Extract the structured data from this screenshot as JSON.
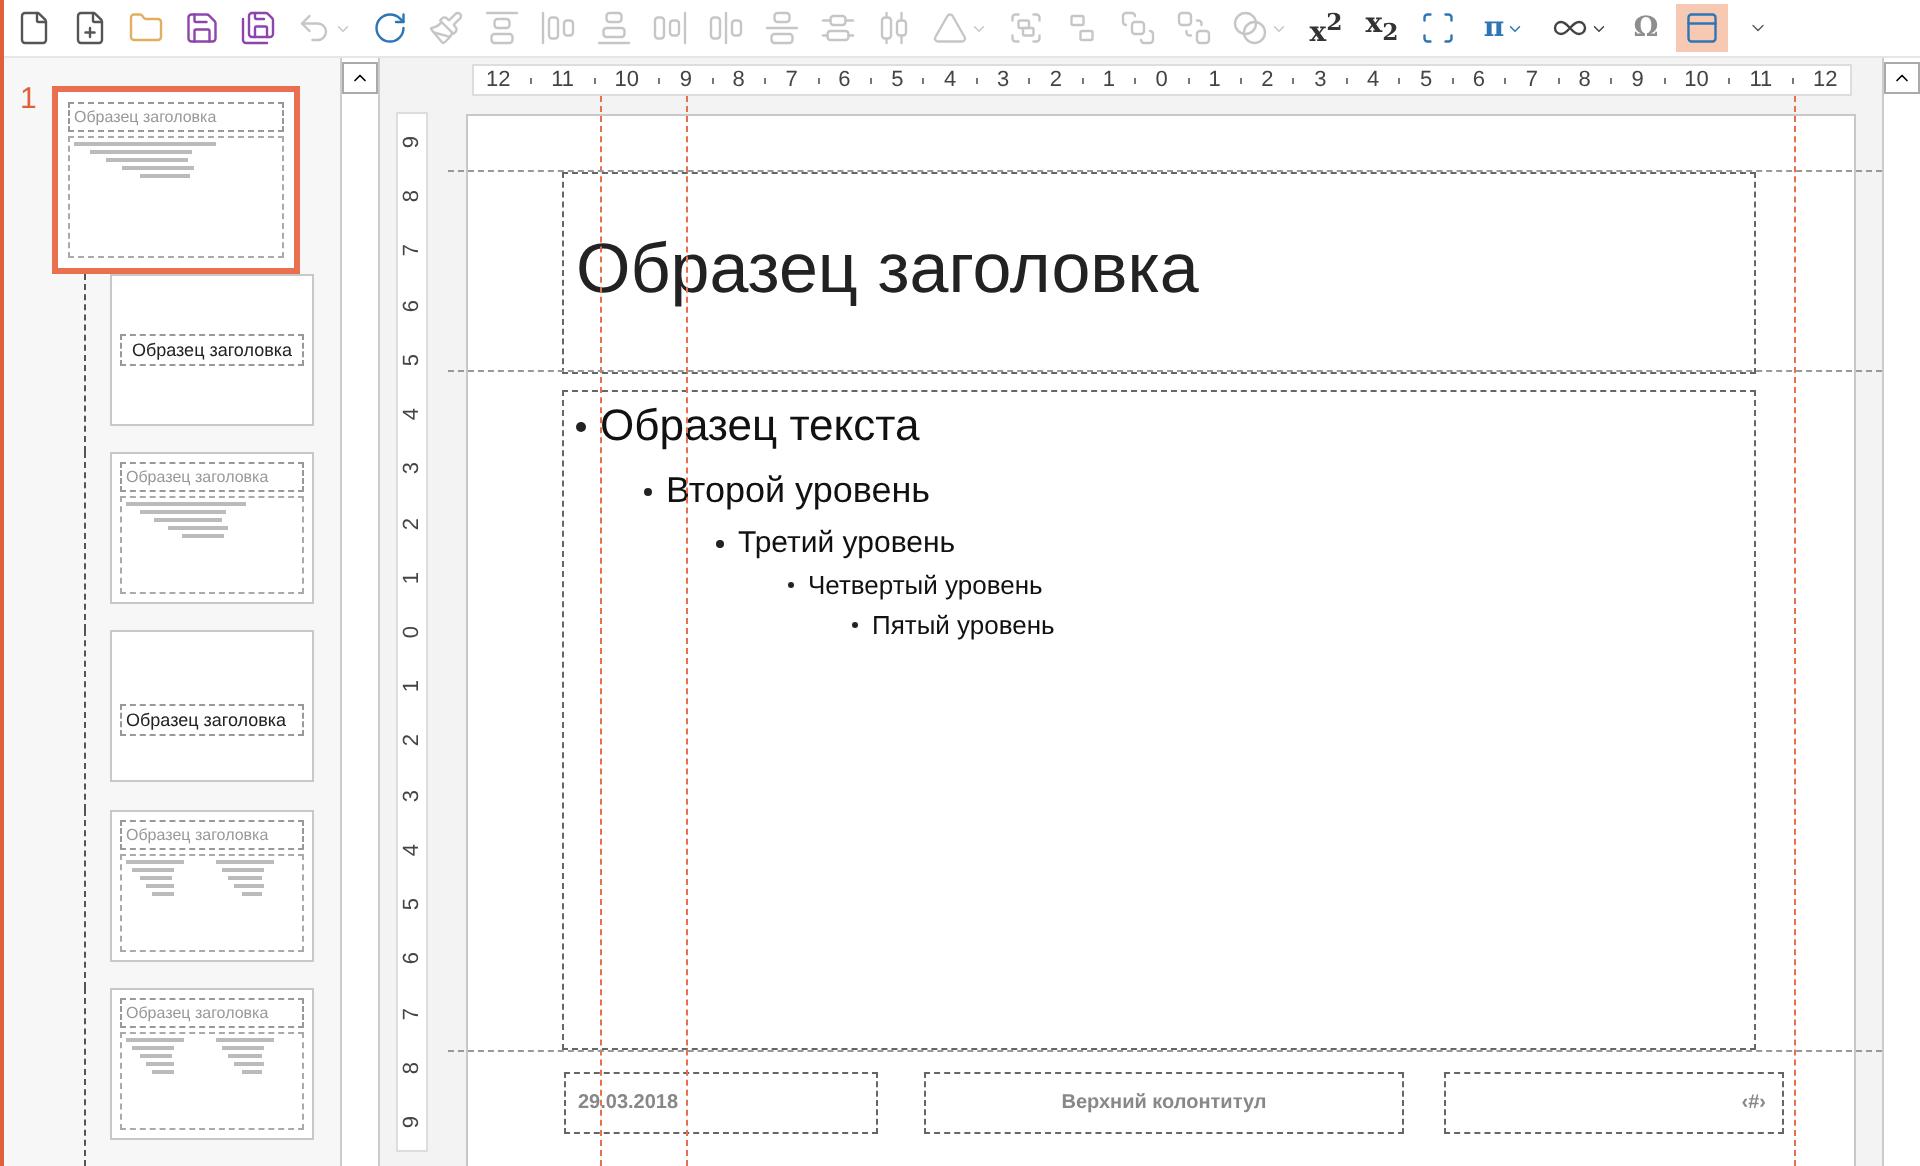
{
  "toolbar": [
    {
      "kind": "new",
      "dropdown": false,
      "selected": false
    },
    {
      "kind": "new-blank",
      "dropdown": false,
      "selected": false
    },
    {
      "kind": "open",
      "dropdown": false,
      "selected": false
    },
    {
      "kind": "save",
      "dropdown": false,
      "selected": false
    },
    {
      "kind": "save-as",
      "dropdown": false,
      "selected": false
    },
    {
      "kind": "undo",
      "dropdown": true,
      "selected": false,
      "disabled": true
    },
    {
      "kind": "redo",
      "dropdown": false,
      "selected": false
    },
    {
      "kind": "format-painter",
      "dropdown": false,
      "selected": false,
      "disabled": true
    },
    {
      "kind": "align-top",
      "dropdown": false,
      "selected": false,
      "disabled": true
    },
    {
      "kind": "align-left",
      "dropdown": false,
      "selected": false,
      "disabled": true
    },
    {
      "kind": "align-bottom",
      "dropdown": false,
      "selected": false,
      "disabled": true
    },
    {
      "kind": "align-right",
      "dropdown": false,
      "selected": false,
      "disabled": true
    },
    {
      "kind": "align-center",
      "dropdown": false,
      "selected": false,
      "disabled": true
    },
    {
      "kind": "align-middle",
      "dropdown": false,
      "selected": false,
      "disabled": true
    },
    {
      "kind": "distribute-vertical",
      "dropdown": false,
      "selected": false,
      "disabled": true
    },
    {
      "kind": "distribute-horizontal",
      "dropdown": false,
      "selected": false,
      "disabled": true
    },
    {
      "kind": "rotate",
      "dropdown": true,
      "selected": false,
      "disabled": true
    },
    {
      "kind": "group",
      "dropdown": false,
      "selected": false,
      "disabled": true
    },
    {
      "kind": "ungroup",
      "dropdown": false,
      "selected": false,
      "disabled": true
    },
    {
      "kind": "bring-front",
      "dropdown": false,
      "selected": false,
      "disabled": true
    },
    {
      "kind": "send-back",
      "dropdown": false,
      "selected": false,
      "disabled": true
    },
    {
      "kind": "shapes",
      "dropdown": true,
      "selected": false,
      "disabled": true
    },
    {
      "kind": "text",
      "label": "x$^{2}$",
      "dropdown": false,
      "selected": false
    },
    {
      "kind": "text",
      "label": "x$_{2}$",
      "dropdown": false,
      "selected": false
    },
    {
      "kind": "fit",
      "dropdown": false,
      "selected": false
    },
    {
      "kind": "text",
      "label": "π",
      "dropdown": true,
      "selected": false,
      "accent": true
    },
    {
      "kind": "infinity",
      "dropdown": true,
      "selected": false
    },
    {
      "kind": "text",
      "label": "Ω",
      "dropdown": false,
      "selected": false,
      "disabled": true
    },
    {
      "kind": "ruler-view",
      "dropdown": false,
      "selected": true
    },
    {
      "kind": "overflow",
      "dropdown": false,
      "selected": false
    }
  ],
  "thumbnails": [
    {
      "number": "1",
      "kind": "content",
      "title": "Образец заголовка",
      "selected": true
    },
    {
      "kind": "title",
      "title": "Образец заголовка",
      "selected": false
    },
    {
      "kind": "content",
      "title": "Образец заголовка",
      "selected": false
    },
    {
      "kind": "section",
      "title": "Образец заголовка",
      "selected": false
    },
    {
      "kind": "two",
      "title": "Образец заголовка",
      "selected": false
    },
    {
      "kind": "two",
      "title": "Образец заголовка",
      "selected": false
    }
  ],
  "ruler_h": [
    "12",
    "11",
    "10",
    "9",
    "8",
    "7",
    "6",
    "5",
    "4",
    "3",
    "2",
    "1",
    "0",
    "1",
    "2",
    "3",
    "4",
    "5",
    "6",
    "7",
    "8",
    "9",
    "10",
    "11",
    "12"
  ],
  "ruler_v": [
    "9",
    "8",
    "7",
    "6",
    "5",
    "4",
    "3",
    "2",
    "1",
    "0",
    "1",
    "2",
    "3",
    "4",
    "5",
    "6",
    "7",
    "8",
    "9"
  ],
  "slide": {
    "title": "Образец заголовка",
    "body": [
      {
        "text": "Образец текста",
        "children": [
          {
            "text": "Второй уровень",
            "children": [
              {
                "text": "Третий уровень",
                "children": [
                  {
                    "text": "Четвертый уровень",
                    "children": [
                      {
                        "text": "Пятый уровень"
                      }
                    ]
                  }
                ]
              }
            ]
          }
        ]
      }
    ],
    "footer": {
      "date": "29.03.2018",
      "center": "Верхний колонтитул",
      "number": "‹#›"
    }
  }
}
